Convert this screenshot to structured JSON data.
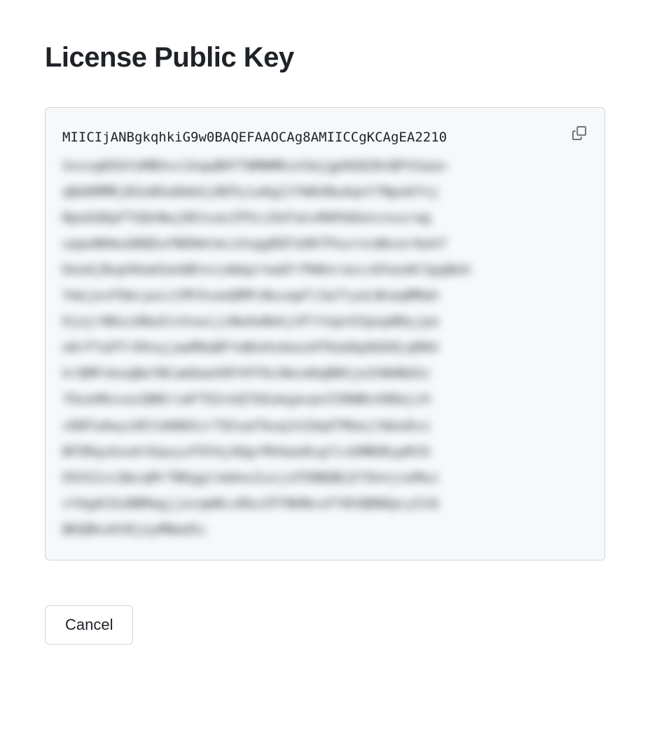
{
  "header": {
    "title": "License Public Key"
  },
  "key": {
    "first_line": "MIICIjANBgkqhkiG9w0BAQEFAAOCAg8AMIICCgKCAgEA2210",
    "blurred_placeholder": "XxxxgKEbYoMBXxv1kqwBHYTWMWMKxnSmjgpHU8ZKnBFhSaav\nqBdOMMRjB3uNSwDmkGj0EPyiw6g2JfW6XNuAqnYfNpo6fnj\nNpoGUDpFTUQnNwjDEnvasIPXccEmTanvMAPmOoncnxurag\nuapeNHmuGNQEafNOHmtmcsXxggRQToOKTPourncWbver6ahf\nDooAjBuphKamSanWEnxioWaprnwbFrPWAnrascxEhasWt3gqNoh\nYmejevFOmcywicCMYXveeQMPcNuvapFi3aftyeLNnaqMMah\nHjajrNOui6NuGtxhxwijzNwXwNekjVFtYepnSSpopB0yjpo\no6rFYaFFrOhnyjawMOaBFtmBsHzAeosHT6ob6p6QX8jqMAh\nkrQMFnkoqBeYBCamOaohRFXFF6v9mcmOqBN5je2hBHBdSc\nfOseHKxvazQNOrimFTO2vkQ7bEakgavpnISRWBxV00ajzh\nv6NTwAwys85tdANGhzrTQtwaTbuqJnZdqXTMoejtWoo6xi\nBFORqzbvwht6qxyzFOYmjAQgrMVAao8vgfivGMBOKypMJh\nOSh52zcQmzqMrTBKgglnmAnuIuzjxFEBBQBjEfOnnjveMuz\nvYAgACOzBBMagjjozqmNcsRbzZFFBHNvsFY8VQBNOpcy516\nBKQBkxKV8joyMNad5c"
  },
  "actions": {
    "cancel_label": "Cancel"
  }
}
